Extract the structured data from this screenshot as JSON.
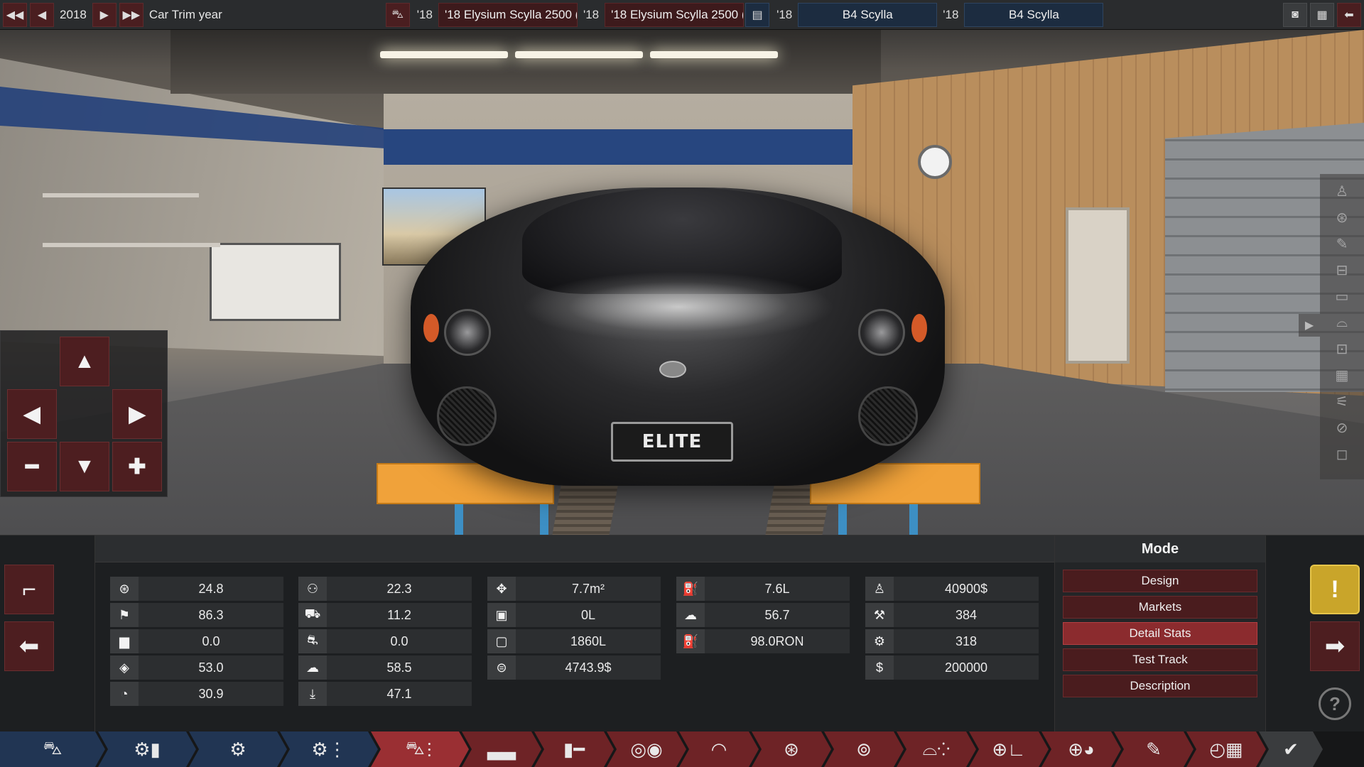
{
  "topbar": {
    "year": "2018",
    "trim_label": "Car Trim year",
    "slot1_year": "'18",
    "slot1_name": "'18 Elysium Scylla 2500 (",
    "slot2_year": "'18",
    "slot2_name": "'18 Elysium Scylla 2500 (",
    "slot3_year": "'18",
    "slot3_name": "B4 Scylla",
    "slot4_year": "'18",
    "slot4_name": "B4 Scylla"
  },
  "scene": {
    "plate_text": "ELITE"
  },
  "stats": {
    "col1": [
      {
        "icon": "steering-wheel-icon",
        "glyph": "⊛",
        "value": "24.8"
      },
      {
        "icon": "checkered-flag-icon",
        "glyph": "⚑",
        "value": "86.3"
      },
      {
        "icon": "seat-icon",
        "glyph": "▆",
        "value": "0.0"
      },
      {
        "icon": "diamond-icon",
        "glyph": "◈",
        "value": "53.0"
      },
      {
        "icon": "pie-icon",
        "glyph": "◔",
        "value": "30.9"
      }
    ],
    "col2": [
      {
        "icon": "people-icon",
        "glyph": "⚇",
        "value": "22.3"
      },
      {
        "icon": "truck-icon",
        "glyph": "⛟",
        "value": "11.2"
      },
      {
        "icon": "offroad-car-icon",
        "glyph": "⛐",
        "value": "0.0"
      },
      {
        "icon": "environment-icon",
        "glyph": "☁",
        "value": "58.5"
      },
      {
        "icon": "trend-down-icon",
        "glyph": "⤓",
        "value": "47.1"
      }
    ],
    "col3": [
      {
        "icon": "move-arrows-icon",
        "glyph": "✥",
        "value": "7.7m²"
      },
      {
        "icon": "cargo-box-icon",
        "glyph": "▣",
        "value": "0L"
      },
      {
        "icon": "passenger-volume-icon",
        "glyph": "▢",
        "value": "1860L"
      },
      {
        "icon": "cost-coins-icon",
        "glyph": "⊜",
        "value": "4743.9$"
      }
    ],
    "col4": [
      {
        "icon": "fuel-can-icon",
        "glyph": "⛽",
        "value": "7.6L"
      },
      {
        "icon": "emissions-icon",
        "glyph": "☁",
        "value": "56.7"
      },
      {
        "icon": "fuel-pump-icon",
        "glyph": "⛽",
        "value": "98.0RON"
      }
    ],
    "col5": [
      {
        "icon": "price-person-icon",
        "glyph": "♙",
        "value": "40900$"
      },
      {
        "icon": "anvil-icon",
        "glyph": "⚒",
        "value": "384"
      },
      {
        "icon": "gear-icon",
        "glyph": "⚙",
        "value": "318"
      },
      {
        "icon": "dollar-icon",
        "glyph": "$",
        "value": "200000"
      }
    ]
  },
  "mode": {
    "title": "Mode",
    "buttons": [
      "Design",
      "Markets",
      "Detail Stats",
      "Test Track",
      "Description"
    ],
    "active": "Detail Stats"
  }
}
